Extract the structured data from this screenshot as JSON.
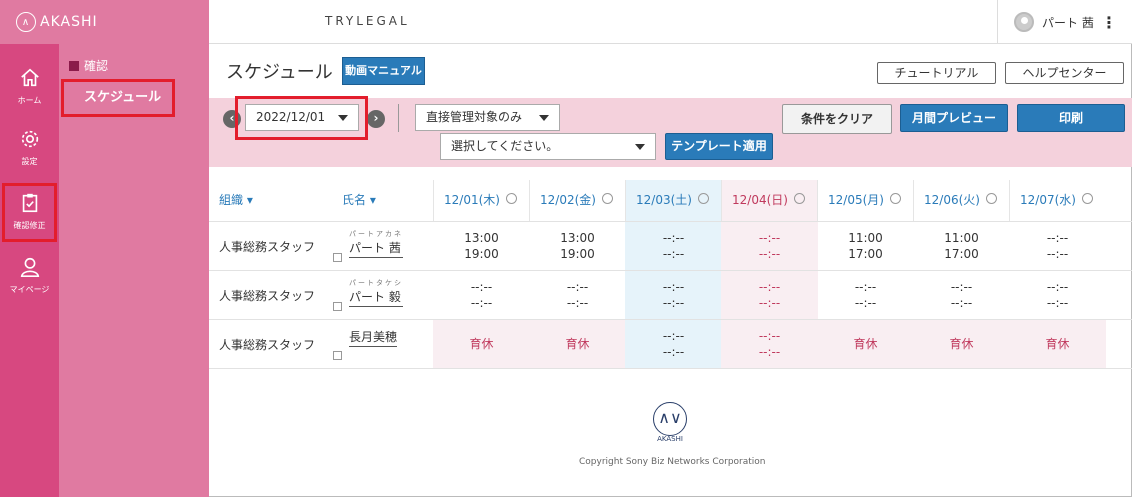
{
  "app": {
    "logo_text": "AKASHI",
    "brand": "TRYLEGAL"
  },
  "user": {
    "name": "パート 茜",
    "menu_glyph": "⋮"
  },
  "sidebar": {
    "items": [
      {
        "label": "ホーム",
        "icon": "home-icon"
      },
      {
        "label": "設定",
        "icon": "gear-icon"
      },
      {
        "label": "確認修正",
        "icon": "clipboard-check-icon"
      },
      {
        "label": "マイページ",
        "icon": "person-icon"
      }
    ],
    "sub_category": "確認",
    "sub_item": "スケジュール"
  },
  "page": {
    "title": "スケジュール",
    "manual_button": "動画マニュアル",
    "tutorial_button": "チュートリアル",
    "help_button": "ヘルプセンター"
  },
  "filter": {
    "date_value": "2022/12/01",
    "prev_glyph": "‹",
    "next_glyph": "›",
    "scope_value": "直接管理対象のみ",
    "template_placeholder": "選択してください。",
    "template_button": "テンプレート適用",
    "clear_button": "条件をクリア",
    "monthly_preview_button": "月間プレビュー",
    "print_button": "印刷"
  },
  "table": {
    "org_header": "組織",
    "name_header": "氏名",
    "days": [
      {
        "label": "12/01(木)",
        "type": "weekday"
      },
      {
        "label": "12/02(金)",
        "type": "weekday"
      },
      {
        "label": "12/03(土)",
        "type": "saturday"
      },
      {
        "label": "12/04(日)",
        "type": "sunday"
      },
      {
        "label": "12/05(月)",
        "type": "weekday"
      },
      {
        "label": "12/06(火)",
        "type": "weekday"
      },
      {
        "label": "12/07(水)",
        "type": "weekday"
      }
    ],
    "rows": [
      {
        "org": "人事総務スタッフ",
        "furigana": "パートアカネ",
        "name": "パート 茜",
        "cells": [
          [
            "13:00",
            "19:00"
          ],
          [
            "13:00",
            "19:00"
          ],
          [
            "--:--",
            "--:--"
          ],
          [
            "--:--",
            "--:--"
          ],
          [
            "11:00",
            "17:00"
          ],
          [
            "11:00",
            "17:00"
          ],
          [
            "--:--",
            "--:--"
          ]
        ]
      },
      {
        "org": "人事総務スタッフ",
        "furigana": "パートタケシ",
        "name": "パート 毅",
        "cells": [
          [
            "--:--",
            "--:--"
          ],
          [
            "--:--",
            "--:--"
          ],
          [
            "--:--",
            "--:--"
          ],
          [
            "--:--",
            "--:--"
          ],
          [
            "--:--",
            "--:--"
          ],
          [
            "--:--",
            "--:--"
          ],
          [
            "--:--",
            "--:--"
          ]
        ]
      },
      {
        "org": "人事総務スタッフ",
        "furigana": "",
        "name": "長月美穂",
        "cells": [
          [
            "育休"
          ],
          [
            "育休"
          ],
          [
            "--:--",
            "--:--"
          ],
          [
            "--:--",
            "--:--"
          ],
          [
            "育休"
          ],
          [
            "育休"
          ],
          [
            "育休"
          ]
        ]
      }
    ]
  },
  "footer": {
    "logo_text": "AKASHI",
    "copyright": "Copyright Sony Biz Networks Corporation"
  },
  "colors": {
    "sidebar": "#d74880",
    "subnav": "#e07aa1",
    "accent_blue": "#2a7bb9",
    "filter_bg": "#f4d1dc",
    "saturday_bg": "#e6f3fa",
    "sunday_bg": "#f9eef2",
    "highlight_red": "#e31d2c"
  }
}
